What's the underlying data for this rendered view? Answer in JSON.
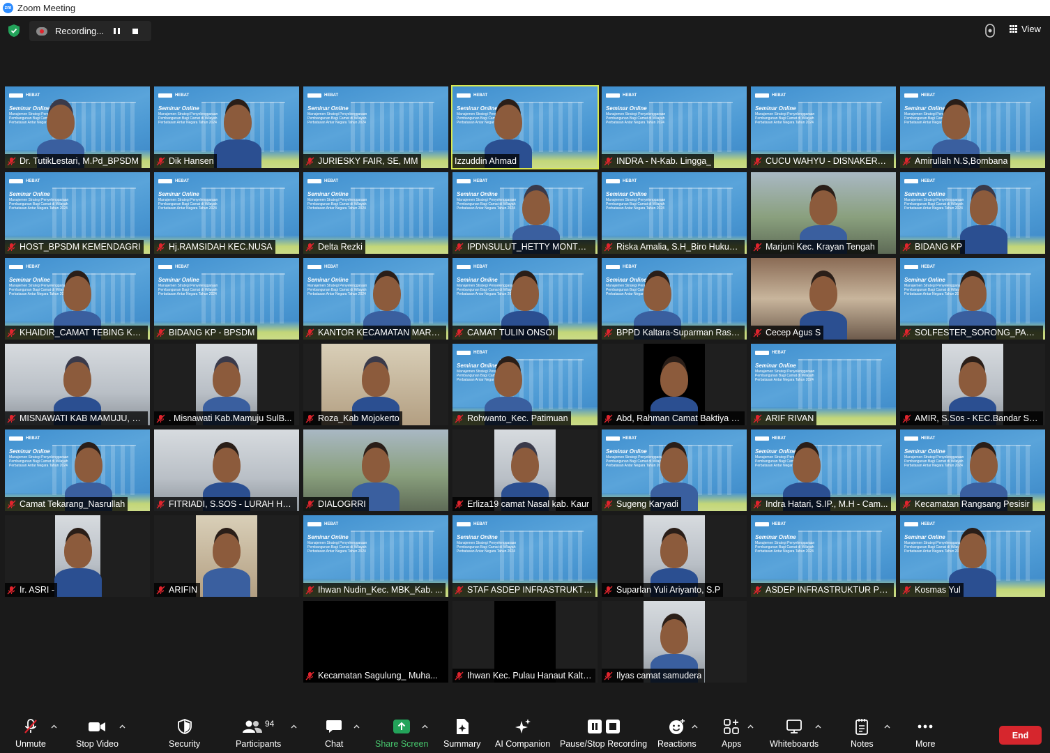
{
  "titlebar": {
    "title": "Zoom Meeting"
  },
  "topbar": {
    "recording_label": "Recording...",
    "view_label": "View"
  },
  "slide": {
    "brand": "HEBAT",
    "title": "Seminar Online",
    "subtitle": "Manajemen Strategi Penyelenggaraan Pembangunan Bagi Camat di Wilayah Perbatasan Antar Negara Tahun 2024"
  },
  "tiles": [
    "Dr. TutikLestari, M.Pd_BPSDM",
    "Dik Hansen",
    "JURIESKY FAIR, SE, MM",
    "Izzuddin Ahmad",
    "INDRA - N-Kab. Lingga_",
    "CUCU WAHYU - DISNAKERTR...",
    "Amirullah N.S,Bombana",
    "HOST_BPSDM KEMENDAGRI",
    "Hj.RAMSIDAH KEC.NUSA",
    "Delta Rezki",
    "IPDNSULUT_HETTY MONTOL...",
    "Riska Amalia, S.H_Biro Hukum...",
    "Marjuni Kec. Krayan Tengah",
    "BIDANG KP",
    "KHAIDIR_CAMAT TEBING KAB ...",
    "BIDANG KP - BPSDM",
    "KANTOR KECAMATAN MARAT...",
    "CAMAT TULIN ONSOI",
    "BPPD Kaltara-Suparman Rasyid",
    "Cecep Agus S",
    "SOLFESTER_SORONG_PAPUA ...",
    "MISNAWATI KAB MAMUJU,  S...",
    ". Misnawati  Kab.Mamuju SulB...",
    "Roza_Kab Mojokerto",
    "Rohwanto_Kec. Patimuan",
    "Abd, Rahman Camat Baktiya B...",
    "ARIF RIVAN",
    "AMIR, S.Sos - KEC.Bandar Sei...",
    "Camat Tekarang_Nasrullah",
    "FITRIADI, S.SOS - LURAH HAN...",
    "DIALOGRRI",
    "Erliza19 camat Nasal kab. Kaur",
    "Sugeng Karyadi",
    "Indra Hatari, S.IP., M.H - Cam...",
    "Kecamatan Rangsang Pesisir",
    "Ir. ASRI -",
    "ARIFIN",
    "Ihwan Nudin_Kec. MBK_Kab. ...",
    "STAF ASDEP INFRASTRUKTUR...",
    "Suparlan Yuli Ariyanto, S.P",
    "ASDEP INFRASTRUKTUR PEM...",
    "Kosmas Yul",
    "Kecamatan Sagulung_ Muha...",
    "Ihwan Kec. Pulau Hanaut Kalte...",
    "Ilyas camat samudera"
  ],
  "toolbar": {
    "unmute": "Unmute",
    "stop_video": "Stop Video",
    "security": "Security",
    "participants": "Participants",
    "participants_count": "94",
    "chat": "Chat",
    "share_screen": "Share Screen",
    "summary": "Summary",
    "ai_companion": "AI Companion",
    "pause_stop_recording": "Pause/Stop Recording",
    "reactions": "Reactions",
    "apps": "Apps",
    "whiteboards": "Whiteboards",
    "notes": "Notes",
    "more": "More",
    "end": "End"
  },
  "colors": {
    "accent_green": "#47c76d",
    "end_red": "#d6262d",
    "active_speaker": "#d9e84f",
    "muted_red": "#e0242d"
  }
}
